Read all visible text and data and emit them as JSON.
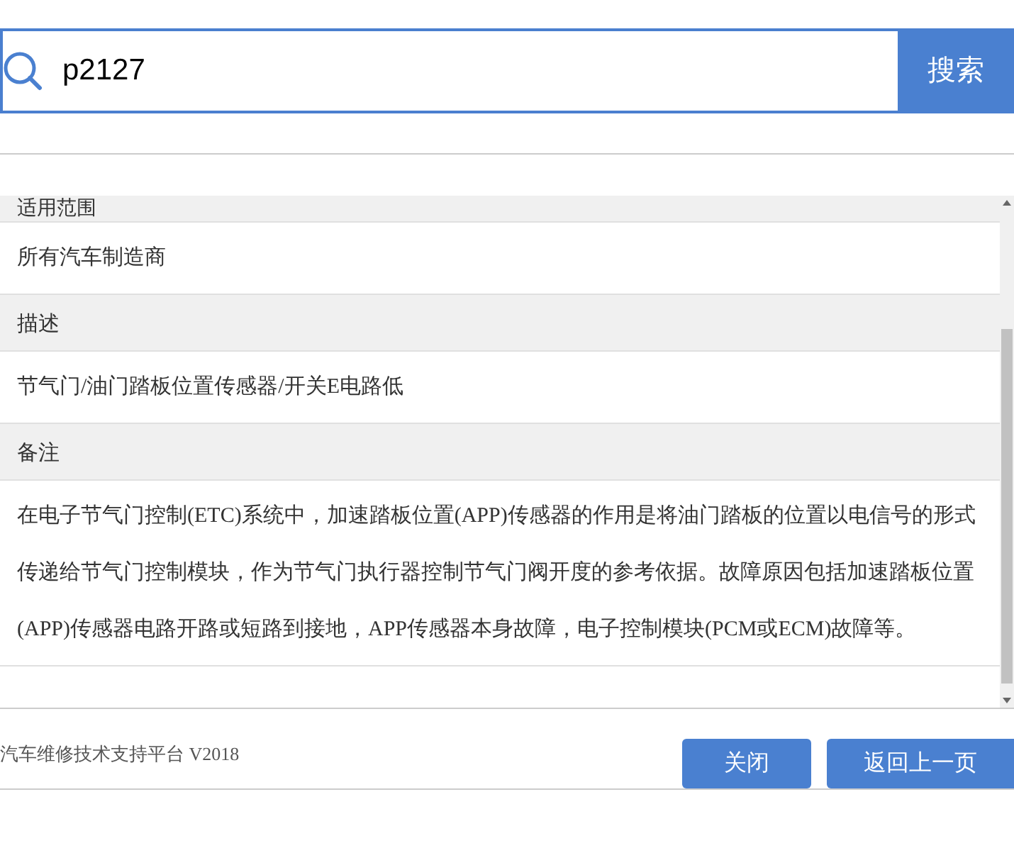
{
  "search": {
    "value": "p2127",
    "button": "搜索"
  },
  "sections": [
    {
      "heading": "适用范围",
      "body": "所有汽车制造商"
    },
    {
      "heading": "描述",
      "body": "节气门/油门踏板位置传感器/开关E电路低"
    },
    {
      "heading": "备注",
      "body": "在电子节气门控制(ETC)系统中，加速踏板位置(APP)传感器的作用是将油门踏板的位置以电信号的形式传递给节气门控制模块，作为节气门执行器控制节气门阀开度的参考依据。故障原因包括加速踏板位置(APP)传感器电路开路或短路到接地，APP传感器本身故障，电子控制模块(PCM或ECM)故障等。"
    }
  ],
  "footer": {
    "text": "汽车维修技术支持平台 V2018",
    "buttons": [
      "关闭",
      "返回上一页"
    ]
  }
}
